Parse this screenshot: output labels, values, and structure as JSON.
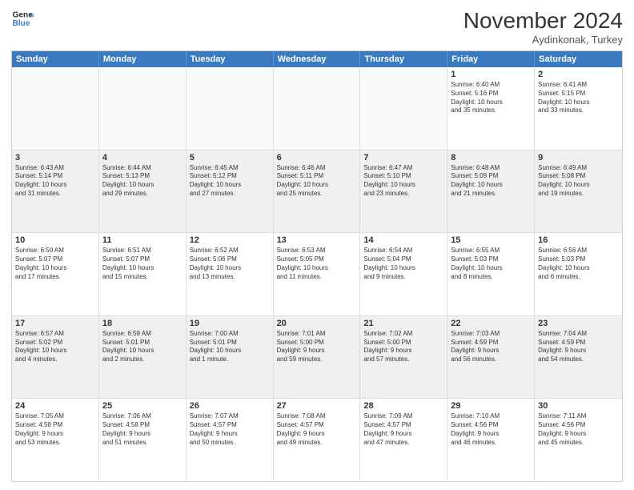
{
  "header": {
    "logo_line1": "General",
    "logo_line2": "Blue",
    "month_title": "November 2024",
    "location": "Aydinkonak, Turkey"
  },
  "days_of_week": [
    "Sunday",
    "Monday",
    "Tuesday",
    "Wednesday",
    "Thursday",
    "Friday",
    "Saturday"
  ],
  "rows": [
    [
      {
        "day": "",
        "text": "",
        "empty": true
      },
      {
        "day": "",
        "text": "",
        "empty": true
      },
      {
        "day": "",
        "text": "",
        "empty": true
      },
      {
        "day": "",
        "text": "",
        "empty": true
      },
      {
        "day": "",
        "text": "",
        "empty": true
      },
      {
        "day": "1",
        "text": "Sunrise: 6:40 AM\nSunset: 5:16 PM\nDaylight: 10 hours\nand 35 minutes.",
        "empty": false
      },
      {
        "day": "2",
        "text": "Sunrise: 6:41 AM\nSunset: 5:15 PM\nDaylight: 10 hours\nand 33 minutes.",
        "empty": false
      }
    ],
    [
      {
        "day": "3",
        "text": "Sunrise: 6:43 AM\nSunset: 5:14 PM\nDaylight: 10 hours\nand 31 minutes.",
        "empty": false
      },
      {
        "day": "4",
        "text": "Sunrise: 6:44 AM\nSunset: 5:13 PM\nDaylight: 10 hours\nand 29 minutes.",
        "empty": false
      },
      {
        "day": "5",
        "text": "Sunrise: 6:45 AM\nSunset: 5:12 PM\nDaylight: 10 hours\nand 27 minutes.",
        "empty": false
      },
      {
        "day": "6",
        "text": "Sunrise: 6:46 AM\nSunset: 5:11 PM\nDaylight: 10 hours\nand 25 minutes.",
        "empty": false
      },
      {
        "day": "7",
        "text": "Sunrise: 6:47 AM\nSunset: 5:10 PM\nDaylight: 10 hours\nand 23 minutes.",
        "empty": false
      },
      {
        "day": "8",
        "text": "Sunrise: 6:48 AM\nSunset: 5:09 PM\nDaylight: 10 hours\nand 21 minutes.",
        "empty": false
      },
      {
        "day": "9",
        "text": "Sunrise: 6:49 AM\nSunset: 5:08 PM\nDaylight: 10 hours\nand 19 minutes.",
        "empty": false
      }
    ],
    [
      {
        "day": "10",
        "text": "Sunrise: 6:50 AM\nSunset: 5:07 PM\nDaylight: 10 hours\nand 17 minutes.",
        "empty": false
      },
      {
        "day": "11",
        "text": "Sunrise: 6:51 AM\nSunset: 5:07 PM\nDaylight: 10 hours\nand 15 minutes.",
        "empty": false
      },
      {
        "day": "12",
        "text": "Sunrise: 6:52 AM\nSunset: 5:06 PM\nDaylight: 10 hours\nand 13 minutes.",
        "empty": false
      },
      {
        "day": "13",
        "text": "Sunrise: 6:53 AM\nSunset: 5:05 PM\nDaylight: 10 hours\nand 11 minutes.",
        "empty": false
      },
      {
        "day": "14",
        "text": "Sunrise: 6:54 AM\nSunset: 5:04 PM\nDaylight: 10 hours\nand 9 minutes.",
        "empty": false
      },
      {
        "day": "15",
        "text": "Sunrise: 6:55 AM\nSunset: 5:03 PM\nDaylight: 10 hours\nand 8 minutes.",
        "empty": false
      },
      {
        "day": "16",
        "text": "Sunrise: 6:56 AM\nSunset: 5:03 PM\nDaylight: 10 hours\nand 6 minutes.",
        "empty": false
      }
    ],
    [
      {
        "day": "17",
        "text": "Sunrise: 6:57 AM\nSunset: 5:02 PM\nDaylight: 10 hours\nand 4 minutes.",
        "empty": false
      },
      {
        "day": "18",
        "text": "Sunrise: 6:59 AM\nSunset: 5:01 PM\nDaylight: 10 hours\nand 2 minutes.",
        "empty": false
      },
      {
        "day": "19",
        "text": "Sunrise: 7:00 AM\nSunset: 5:01 PM\nDaylight: 10 hours\nand 1 minute.",
        "empty": false
      },
      {
        "day": "20",
        "text": "Sunrise: 7:01 AM\nSunset: 5:00 PM\nDaylight: 9 hours\nand 59 minutes.",
        "empty": false
      },
      {
        "day": "21",
        "text": "Sunrise: 7:02 AM\nSunset: 5:00 PM\nDaylight: 9 hours\nand 57 minutes.",
        "empty": false
      },
      {
        "day": "22",
        "text": "Sunrise: 7:03 AM\nSunset: 4:59 PM\nDaylight: 9 hours\nand 56 minutes.",
        "empty": false
      },
      {
        "day": "23",
        "text": "Sunrise: 7:04 AM\nSunset: 4:59 PM\nDaylight: 9 hours\nand 54 minutes.",
        "empty": false
      }
    ],
    [
      {
        "day": "24",
        "text": "Sunrise: 7:05 AM\nSunset: 4:58 PM\nDaylight: 9 hours\nand 53 minutes.",
        "empty": false
      },
      {
        "day": "25",
        "text": "Sunrise: 7:06 AM\nSunset: 4:58 PM\nDaylight: 9 hours\nand 51 minutes.",
        "empty": false
      },
      {
        "day": "26",
        "text": "Sunrise: 7:07 AM\nSunset: 4:57 PM\nDaylight: 9 hours\nand 50 minutes.",
        "empty": false
      },
      {
        "day": "27",
        "text": "Sunrise: 7:08 AM\nSunset: 4:57 PM\nDaylight: 9 hours\nand 49 minutes.",
        "empty": false
      },
      {
        "day": "28",
        "text": "Sunrise: 7:09 AM\nSunset: 4:57 PM\nDaylight: 9 hours\nand 47 minutes.",
        "empty": false
      },
      {
        "day": "29",
        "text": "Sunrise: 7:10 AM\nSunset: 4:56 PM\nDaylight: 9 hours\nand 46 minutes.",
        "empty": false
      },
      {
        "day": "30",
        "text": "Sunrise: 7:11 AM\nSunset: 4:56 PM\nDaylight: 9 hours\nand 45 minutes.",
        "empty": false
      }
    ]
  ]
}
